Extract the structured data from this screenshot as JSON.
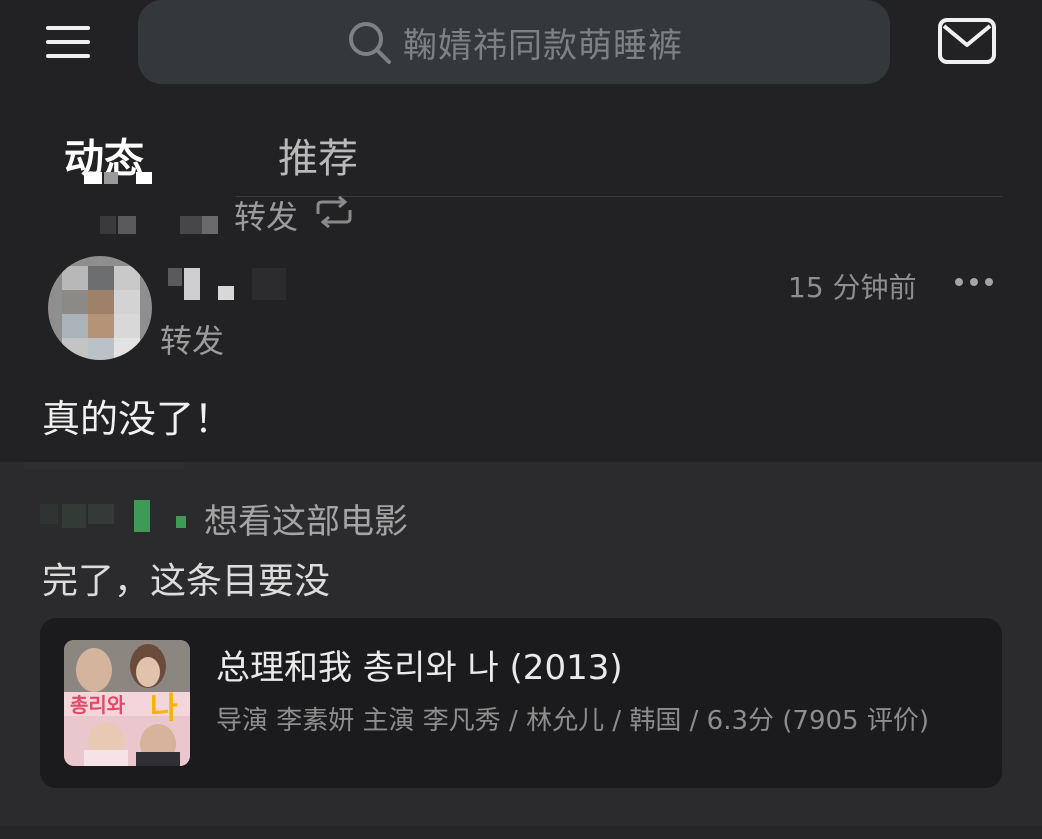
{
  "header": {
    "search_placeholder": "鞠婧祎同款萌睡裤"
  },
  "tabs": [
    {
      "label": "动态",
      "active": true
    },
    {
      "label": "推荐",
      "active": false
    }
  ],
  "feed": {
    "forward_label_top": "转发",
    "post": {
      "time": "15 分钟前",
      "forward_label": "转发",
      "text": "真的没了！"
    },
    "embed": {
      "action": "想看这部电影",
      "text": "完了，这条目要没",
      "movie": {
        "title": "总理和我 총리와 나 (2013)",
        "meta": "导演 李素妍 主演 李凡秀 / 林允儿 / 韩国 / 6.3分 (7905 评价)"
      }
    }
  },
  "colors": {
    "background": "#222224",
    "card": "#1b1b1d",
    "embed_background": "#2b2b2d"
  }
}
